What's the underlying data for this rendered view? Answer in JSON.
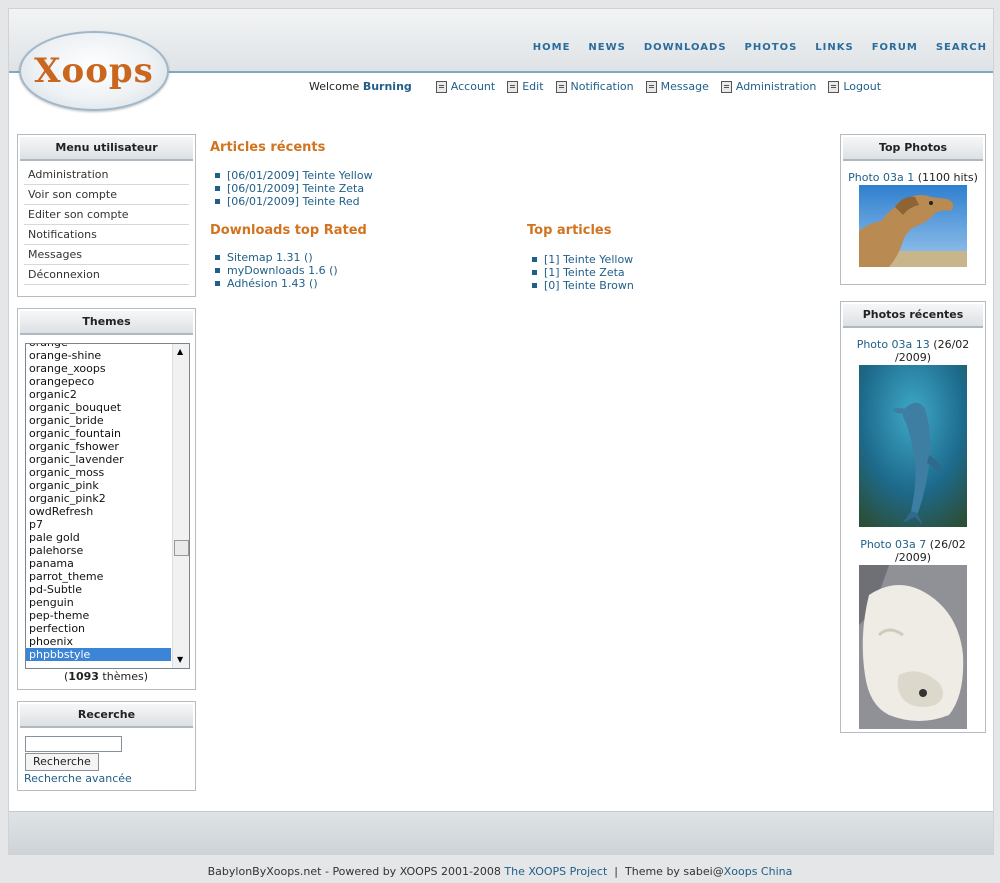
{
  "header": {
    "logo_text": "Xoops",
    "nav": [
      "HOME",
      "NEWS",
      "DOWNLOADS",
      "PHOTOS",
      "LINKS",
      "FORUM",
      "SEARCH"
    ]
  },
  "userbar": {
    "welcome": "Welcome",
    "username": "Burning",
    "links": [
      "Account",
      "Edit",
      "Notification",
      "Message",
      "Administration",
      "Logout"
    ]
  },
  "user_menu": {
    "title": "Menu utilisateur",
    "items": [
      "Administration",
      "Voir son compte",
      "Editer son compte",
      "Notifications",
      "Messages",
      "Déconnexion"
    ]
  },
  "themes": {
    "title": "Themes",
    "items": [
      "orange",
      "orange-shine",
      "orange_xoops",
      "orangepeco",
      "organic2",
      "organic_bouquet",
      "organic_bride",
      "organic_fountain",
      "organic_fshower",
      "organic_lavender",
      "organic_moss",
      "organic_pink",
      "organic_pink2",
      "owdRefresh",
      "p7",
      "pale gold",
      "palehorse",
      "panama",
      "parrot_theme",
      "pd-Subtle",
      "penguin",
      "pep-theme",
      "perfection",
      "phoenix",
      "phpbbstyle"
    ],
    "selected": "phpbbstyle",
    "count": "1093",
    "count_suffix": "thèmes"
  },
  "search": {
    "title": "Recerche",
    "button": "Recherche",
    "input_value": "",
    "advanced": "Recherche avancée"
  },
  "articles_recents": {
    "title": "Articles récents",
    "items": [
      "[06/01/2009] Teinte Yellow",
      "[06/01/2009] Teinte Zeta",
      "[06/01/2009] Teinte Red"
    ]
  },
  "downloads_top": {
    "title": "Downloads top Rated",
    "items": [
      "Sitemap 1.31 ()",
      "myDownloads 1.6 ()",
      "Adhésion 1.43 ()"
    ]
  },
  "top_articles": {
    "title": "Top articles",
    "items": [
      "[1] Teinte Yellow",
      "[1] Teinte Zeta",
      "[0] Teinte Brown"
    ]
  },
  "top_photos": {
    "title": "Top Photos",
    "items": [
      {
        "link": "Photo 03a 1",
        "meta": "(1100 hits)"
      }
    ]
  },
  "recent_photos": {
    "title": "Photos récentes",
    "items": [
      {
        "link": "Photo 03a 13",
        "meta": "(26/02 /2009)"
      },
      {
        "link": "Photo 03a 7",
        "meta": "(26/02 /2009)"
      }
    ]
  },
  "footer": {
    "prefix": "BabylonByXoops.net - Powered by XOOPS 2001-2008",
    "project_link": "The XOOPS Project",
    "separator": "|",
    "theme_by": "Theme by sabei@",
    "china_link": "Xoops China"
  },
  "colors": {
    "accent_orange": "#d2741f",
    "link_blue": "#1f5f88",
    "selection": "#3b84d6"
  }
}
